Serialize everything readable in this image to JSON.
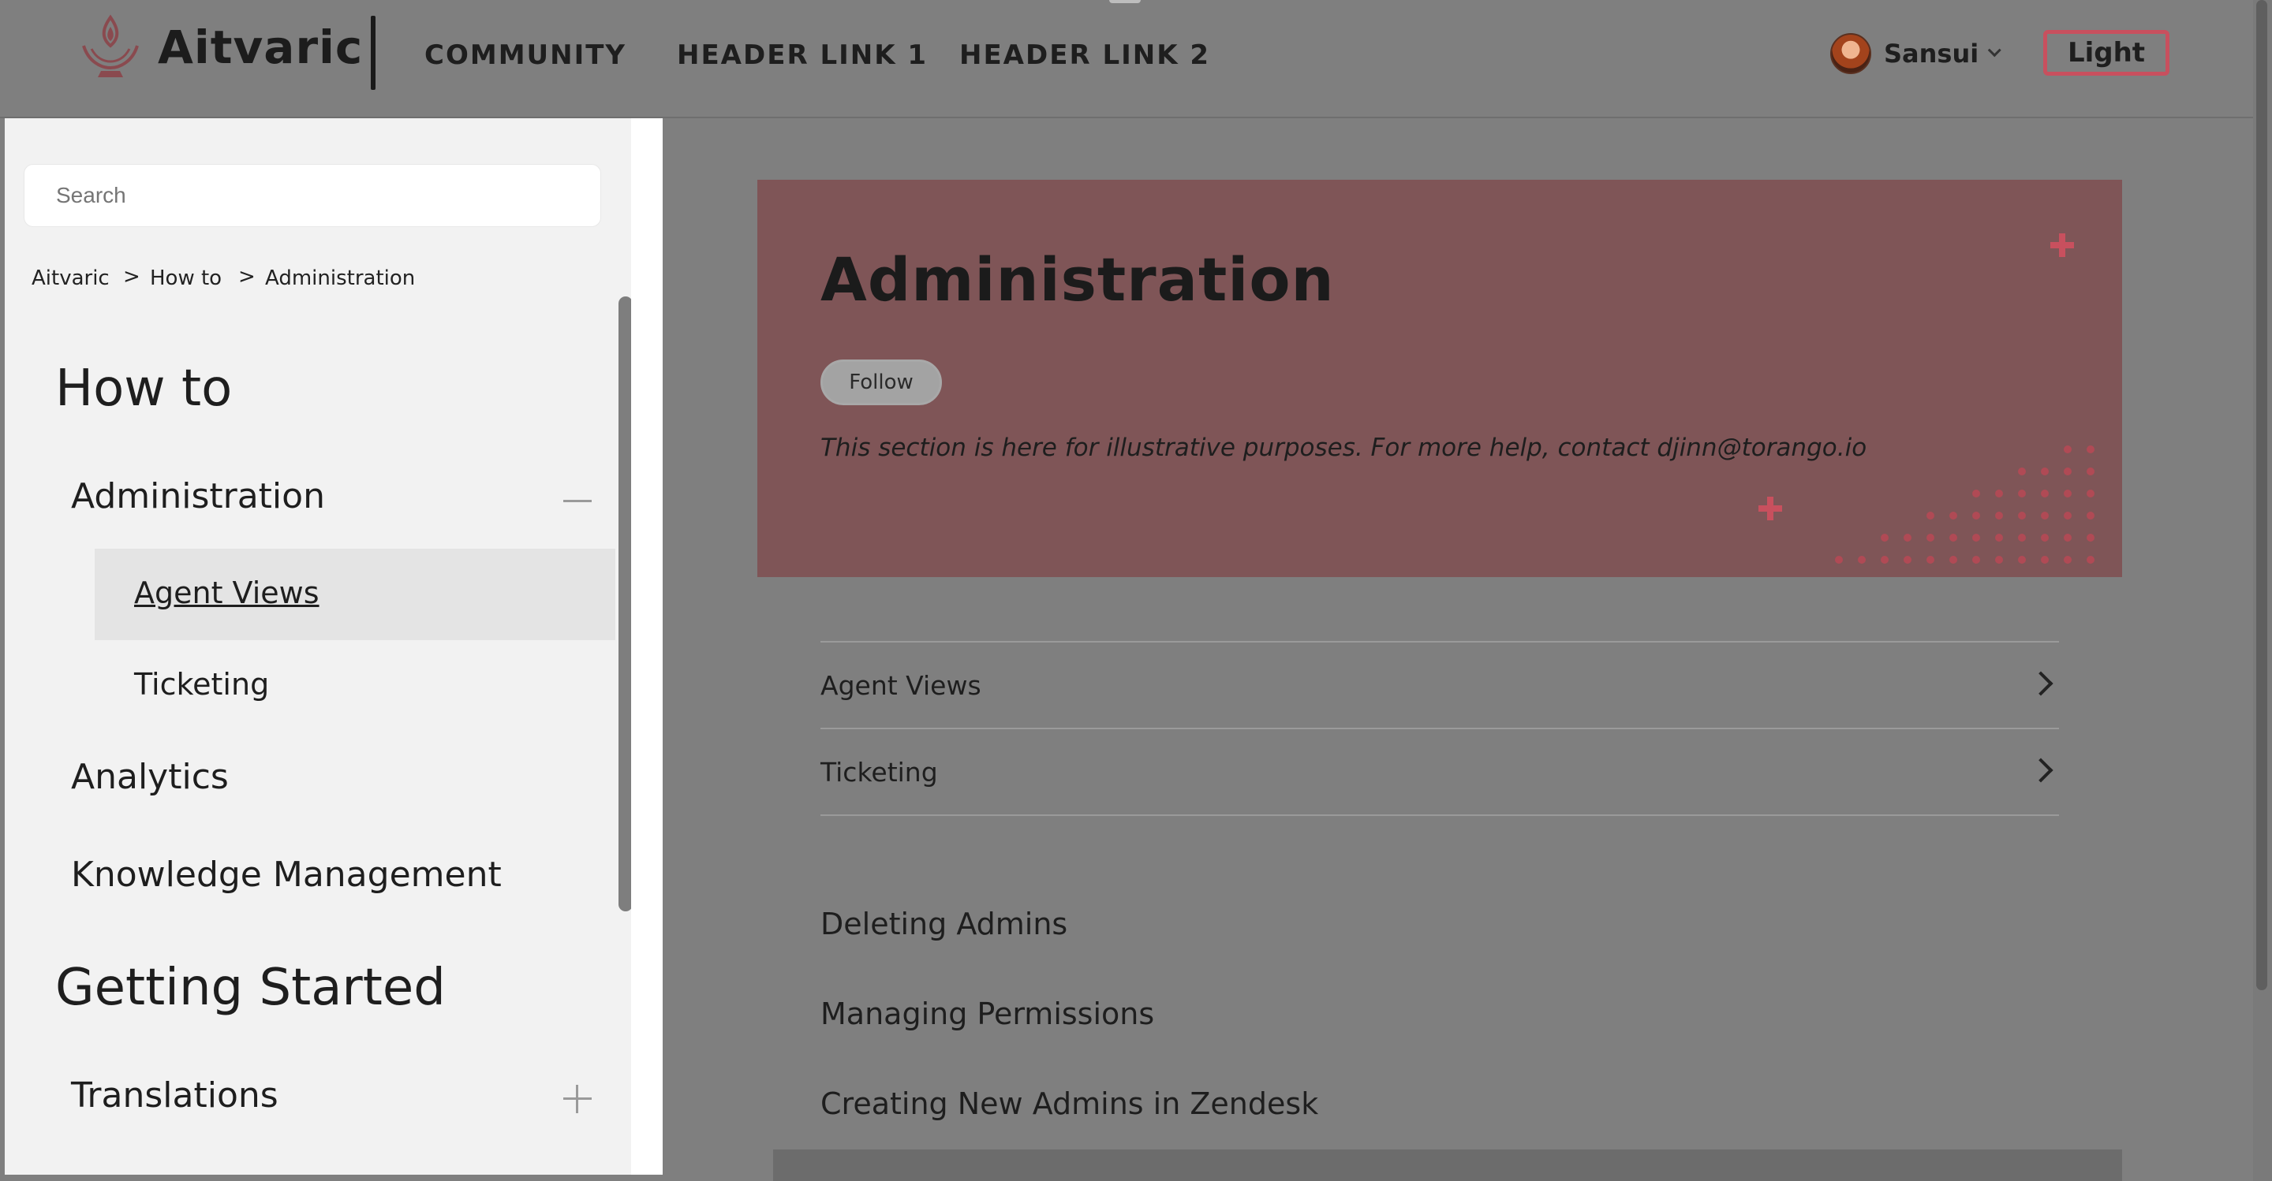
{
  "header": {
    "brand": "Aitvaric",
    "nav": [
      "COMMUNITY",
      "HEADER LINK 1",
      "HEADER LINK 2"
    ],
    "user": {
      "name": "Sansui"
    },
    "theme_button": "Light"
  },
  "sidebar": {
    "search_placeholder": "Search",
    "breadcrumb": [
      "Aitvaric",
      "How to",
      "Administration"
    ],
    "breadcrumb_separator": ">",
    "sections": [
      {
        "title": "How to",
        "categories": [
          {
            "label": "Administration",
            "expanded": true,
            "items": [
              {
                "label": "Agent Views",
                "active": true
              },
              {
                "label": "Ticketing",
                "active": false
              }
            ]
          },
          {
            "label": "Analytics"
          },
          {
            "label": "Knowledge Management"
          }
        ]
      },
      {
        "title": "Getting Started",
        "categories": [
          {
            "label": "Translations",
            "expanded": false
          }
        ]
      }
    ]
  },
  "main": {
    "hero": {
      "title": "Administration",
      "follow_label": "Follow",
      "description": "This section is here for illustrative purposes. For more help, contact djinn@torango.io"
    },
    "subsections": [
      "Agent Views",
      "Ticketing"
    ],
    "articles": [
      "Deleting Admins",
      "Managing Permissions",
      "Creating New Admins in Zendesk"
    ]
  },
  "colors": {
    "accent": "#c8505e",
    "hero_bg": "#7f5557",
    "overlay_bg": "#7f7f7f",
    "sidebar_bg": "#f2f2f2"
  }
}
